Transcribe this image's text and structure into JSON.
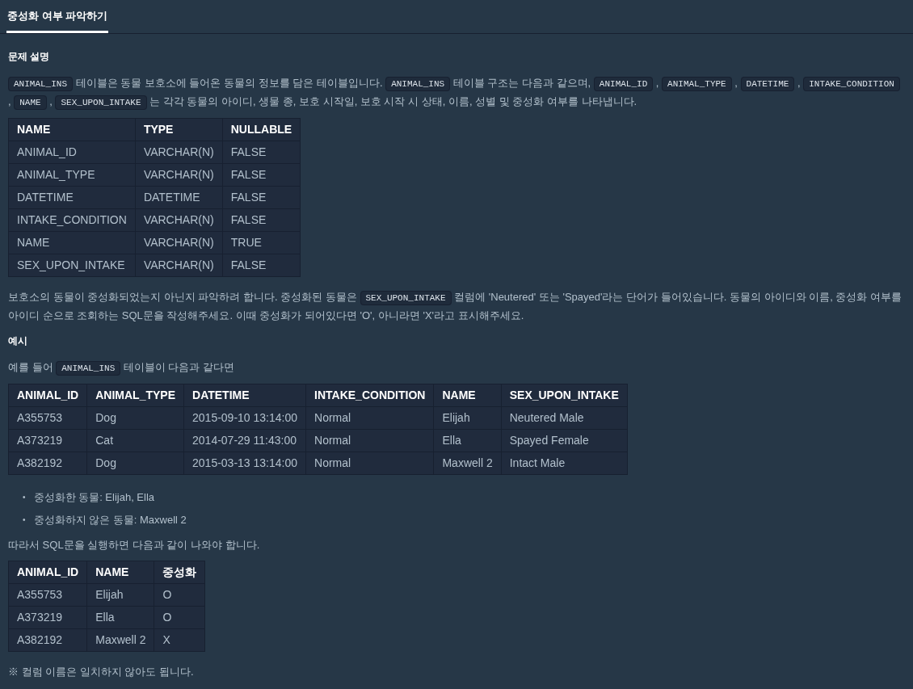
{
  "tabs": [
    {
      "label": "중성화 여부 파악하기",
      "selected": true
    }
  ],
  "blocks": [
    {
      "kind": "heading",
      "text": "문제 설명"
    },
    {
      "kind": "paragraph",
      "segments": [
        {
          "kind": "code",
          "text": "ANIMAL_INS"
        },
        {
          "kind": "text",
          "text": " 테이블은 동물 보호소에 들어온 동물의 정보를 담은 테이블입니다. "
        },
        {
          "kind": "code",
          "text": "ANIMAL_INS"
        },
        {
          "kind": "text",
          "text": " 테이블 구조는 다음과 같으며, "
        },
        {
          "kind": "code",
          "text": "ANIMAL_ID"
        },
        {
          "kind": "text",
          "text": " , "
        },
        {
          "kind": "code",
          "text": "ANIMAL_TYPE"
        },
        {
          "kind": "text",
          "text": " , "
        },
        {
          "kind": "code",
          "text": "DATETIME"
        },
        {
          "kind": "text",
          "text": " , "
        },
        {
          "kind": "code",
          "text": "INTAKE_CONDITION"
        },
        {
          "kind": "text",
          "text": " , "
        },
        {
          "kind": "code",
          "text": "NAME"
        },
        {
          "kind": "text",
          "text": " , "
        },
        {
          "kind": "code",
          "text": "SEX_UPON_INTAKE"
        },
        {
          "kind": "text",
          "text": " 는 각각 동물의 아이디, 생물 종, 보호 시작일, 보호 시작 시 상태, 이름, 성별 및 중성화 여부를 나타냅니다."
        }
      ]
    },
    {
      "kind": "table",
      "columns": [
        "NAME",
        "TYPE",
        "NULLABLE"
      ],
      "rows": [
        [
          "ANIMAL_ID",
          "VARCHAR(N)",
          "FALSE"
        ],
        [
          "ANIMAL_TYPE",
          "VARCHAR(N)",
          "FALSE"
        ],
        [
          "DATETIME",
          "DATETIME",
          "FALSE"
        ],
        [
          "INTAKE_CONDITION",
          "VARCHAR(N)",
          "FALSE"
        ],
        [
          "NAME",
          "VARCHAR(N)",
          "TRUE"
        ],
        [
          "SEX_UPON_INTAKE",
          "VARCHAR(N)",
          "FALSE"
        ]
      ]
    },
    {
      "kind": "paragraph",
      "segments": [
        {
          "kind": "text",
          "text": "보호소의 동물이 중성화되었는지 아닌지 파악하려 합니다. 중성화된 동물은 "
        },
        {
          "kind": "code",
          "text": "SEX_UPON_INTAKE"
        },
        {
          "kind": "text",
          "text": " 컬럼에 'Neutered' 또는 'Spayed'라는 단어가 들어있습니다. 동물의 아이디와 이름, 중성화 여부를 아이디 순으로 조회하는 SQL문을 작성해주세요. 이때 중성화가 되어있다면 'O', 아니라면 'X'라고 표시해주세요."
        }
      ]
    },
    {
      "kind": "heading",
      "text": "예시"
    },
    {
      "kind": "paragraph",
      "segments": [
        {
          "kind": "text",
          "text": "예를 들어 "
        },
        {
          "kind": "code",
          "text": "ANIMAL_INS"
        },
        {
          "kind": "text",
          "text": " 테이블이 다음과 같다면"
        }
      ]
    },
    {
      "kind": "table",
      "columns": [
        "ANIMAL_ID",
        "ANIMAL_TYPE",
        "DATETIME",
        "INTAKE_CONDITION",
        "NAME",
        "SEX_UPON_INTAKE"
      ],
      "rows": [
        [
          "A355753",
          "Dog",
          "2015-09-10 13:14:00",
          "Normal",
          "Elijah",
          "Neutered Male"
        ],
        [
          "A373219",
          "Cat",
          "2014-07-29 11:43:00",
          "Normal",
          "Ella",
          "Spayed Female"
        ],
        [
          "A382192",
          "Dog",
          "2015-03-13 13:14:00",
          "Normal",
          "Maxwell 2",
          "Intact Male"
        ]
      ]
    },
    {
      "kind": "list",
      "items": [
        {
          "bullet": "•",
          "text": "중성화한 동물: Elijah, Ella"
        },
        {
          "bullet": "•",
          "text": "중성화하지 않은 동물: Maxwell 2"
        }
      ]
    },
    {
      "kind": "paragraph",
      "segments": [
        {
          "kind": "text",
          "text": "따라서 SQL문을 실행하면 다음과 같이 나와야 합니다."
        }
      ]
    },
    {
      "kind": "table",
      "columns": [
        "ANIMAL_ID",
        "NAME",
        "중성화"
      ],
      "rows": [
        [
          "A355753",
          "Elijah",
          "O"
        ],
        [
          "A373219",
          "Ella",
          "O"
        ],
        [
          "A382192",
          "Maxwell 2",
          "X"
        ]
      ]
    },
    {
      "kind": "paragraph",
      "segments": [
        {
          "kind": "text",
          "text": "※ 컬럼 이름은 일치하지 않아도 됩니다."
        }
      ]
    }
  ]
}
